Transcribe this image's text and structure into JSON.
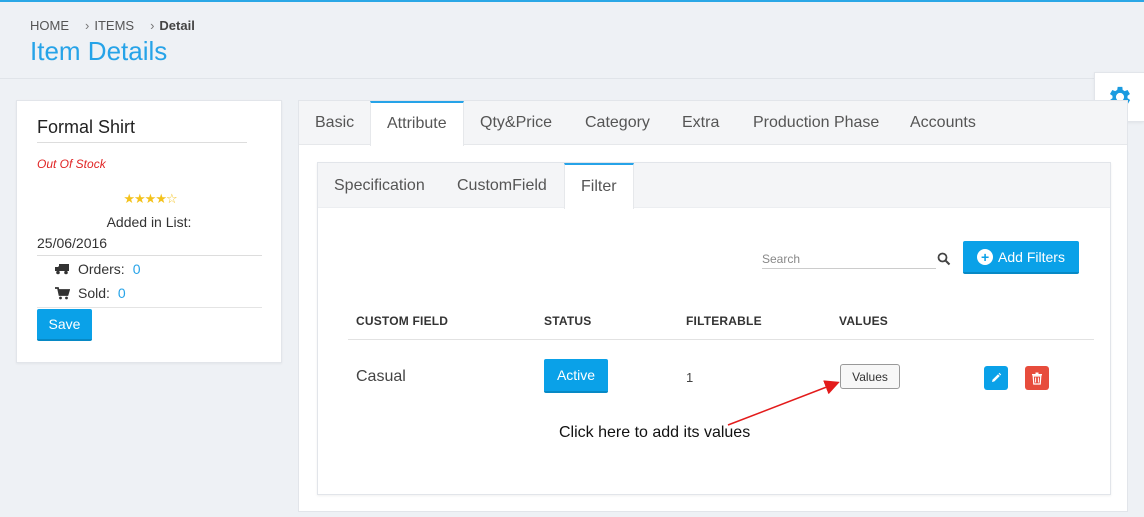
{
  "breadcrumb": {
    "items": [
      "HOME",
      "ITEMS",
      "Detail"
    ],
    "separator": "›"
  },
  "page": {
    "title": "Item Details"
  },
  "product": {
    "name": "Formal Shirt",
    "stock_status": "Out Of Stock",
    "rating": 4,
    "rating_max": 5,
    "added_label": "Added in List:",
    "added_date": "25/06/2016",
    "orders_label": "Orders:",
    "orders_value": "0",
    "sold_label": "Sold:",
    "sold_value": "0",
    "save_label": "Save"
  },
  "tabs": [
    {
      "label": "Basic",
      "active": false
    },
    {
      "label": "Attribute",
      "active": true
    },
    {
      "label": "Qty&Price",
      "active": false
    },
    {
      "label": "Category",
      "active": false
    },
    {
      "label": "Extra",
      "active": false
    },
    {
      "label": "Production Phase",
      "active": false
    },
    {
      "label": "Accounts",
      "active": false
    }
  ],
  "subtabs": [
    {
      "label": "Specification",
      "active": false
    },
    {
      "label": "CustomField",
      "active": false
    },
    {
      "label": "Filter",
      "active": true
    }
  ],
  "filter": {
    "search_placeholder": "Search",
    "add_label": "Add Filters",
    "columns": [
      "CUSTOM FIELD",
      "STATUS",
      "FILTERABLE",
      "VALUES"
    ],
    "rows": [
      {
        "custom_field": "Casual",
        "status": "Active",
        "filterable": "1",
        "values_label": "Values"
      }
    ]
  },
  "annotation": {
    "text": "Click here to add its values",
    "color": "#e31b1b"
  },
  "colors": {
    "accent": "#0aa1e8",
    "danger": "#e74c3c",
    "title": "#26a3e8",
    "stock": "#e02424"
  },
  "icons": {
    "settings": "gear-icon",
    "orders": "truck-icon",
    "sold": "cart-icon",
    "search": "search-icon",
    "add": "plus-circle-icon",
    "edit": "pencil-icon",
    "delete": "trash-icon"
  }
}
